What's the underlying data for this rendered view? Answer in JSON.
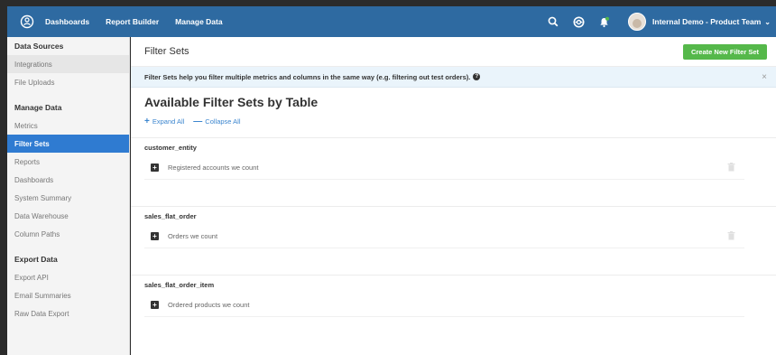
{
  "topnav": {
    "items": [
      {
        "label": "Dashboards",
        "bold": true
      },
      {
        "label": "Report Builder",
        "bold": true
      },
      {
        "label": "Manage Data",
        "bold": true
      }
    ],
    "user_name": "Internal Demo - Product Team",
    "icons": [
      "logo-icon",
      "search-icon",
      "support-icon",
      "notifications-icon",
      "avatar"
    ]
  },
  "sidebar": {
    "sections": [
      {
        "heading": "Data Sources",
        "items": [
          "Integrations",
          "File Uploads"
        ]
      },
      {
        "heading": "Manage Data",
        "items": [
          "Metrics",
          "Filter Sets",
          "Reports",
          "Dashboards",
          "System Summary",
          "Data Warehouse",
          "Column Paths"
        ]
      },
      {
        "heading": "Export Data",
        "items": [
          "Export API",
          "Email Summaries",
          "Raw Data Export"
        ]
      }
    ],
    "active_item": "Filter Sets",
    "hover_item": "Integrations"
  },
  "main": {
    "title": "Filter Sets",
    "create_button": "Create New Filter Set",
    "info_text": "Filter Sets help you filter multiple metrics and columns in the same way (e.g. filtering out test orders).",
    "section_title": "Available Filter Sets by Table",
    "expand_all": "Expand All",
    "collapse_all": "Collapse All",
    "tables": [
      {
        "name": "customer_entity",
        "filter": "Registered accounts we count"
      },
      {
        "name": "sales_flat_order",
        "filter": "Orders we count"
      },
      {
        "name": "sales_flat_order_item",
        "filter": "Ordered products we count"
      }
    ]
  },
  "colors": {
    "navbar": "#2e6aa1",
    "active": "#2f7bd1",
    "create_button": "#55b84a",
    "info_bg": "#eaf4fb",
    "link": "#3c86cf"
  }
}
